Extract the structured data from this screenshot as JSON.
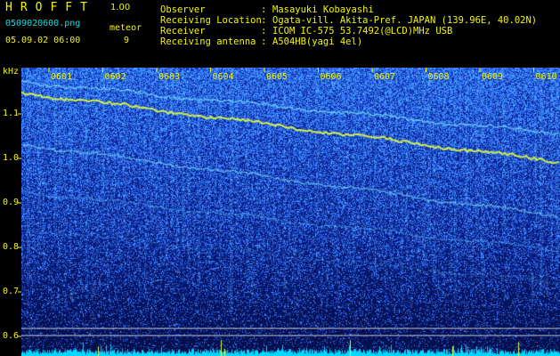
{
  "header": {
    "brand": "HROFFT",
    "version": "1.00",
    "filename": "0509020600.png",
    "datetime": "05.09.02 06:00",
    "meteor_label": "meteor",
    "meteor_count": "9"
  },
  "info": [
    {
      "label": "Observer",
      "value": "Masayuki Kobayashi"
    },
    {
      "label": "Receiving Location",
      "value": "Ogata-vill. Akita-Pref. JAPAN (139.96E, 40.02N)"
    },
    {
      "label": "Receiver",
      "value": "ICOM IC-575 53.7492(@LCD)MHz USB"
    },
    {
      "label": "Receiving antenna",
      "value": "A504HB(yagi 4el)"
    }
  ],
  "spectrogram": {
    "unit": "kHz",
    "freq_ticks": [
      {
        "value": 1.1,
        "label": "1.1"
      },
      {
        "value": 1.0,
        "label": "1.0"
      },
      {
        "value": 0.9,
        "label": "0.9"
      },
      {
        "value": 0.8,
        "label": "0.8"
      },
      {
        "value": 0.7,
        "label": "0.7"
      },
      {
        "value": 0.6,
        "label": "0.6"
      }
    ],
    "time_ticks": [
      "0601",
      "0602",
      "0603",
      "0604",
      "0605",
      "0606",
      "0607",
      "0608",
      "0609",
      "0610"
    ],
    "colors": {
      "background": "#0a1a78",
      "noise": "#2f6cff",
      "trace": "#e6ff3a",
      "secondary": "#7fe8ff",
      "baseline": "#00d8ff"
    }
  }
}
